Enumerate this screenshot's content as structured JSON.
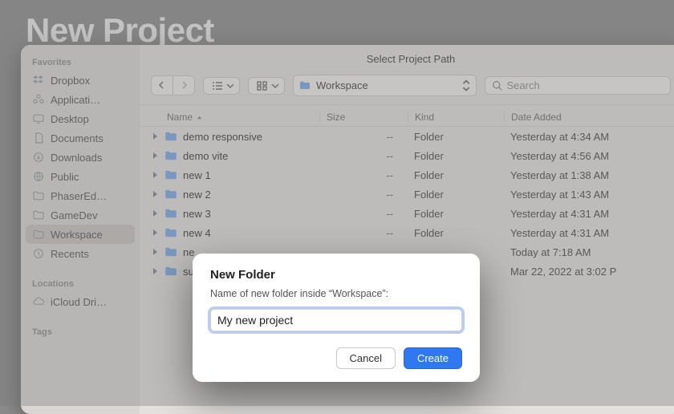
{
  "page_title": "New Project",
  "window_title": "Select Project Path",
  "sidebar": {
    "favorites_label": "Favorites",
    "locations_label": "Locations",
    "tags_label": "Tags",
    "items": [
      {
        "label": "Dropbox",
        "icon": "dropbox"
      },
      {
        "label": "Applicati…",
        "icon": "apps"
      },
      {
        "label": "Desktop",
        "icon": "desktop"
      },
      {
        "label": "Documents",
        "icon": "doc"
      },
      {
        "label": "Downloads",
        "icon": "downloads"
      },
      {
        "label": "Public",
        "icon": "public"
      },
      {
        "label": "PhaserEd…",
        "icon": "folder"
      },
      {
        "label": "GameDev",
        "icon": "folder"
      },
      {
        "label": "Workspace",
        "icon": "folder",
        "selected": true
      },
      {
        "label": "Recents",
        "icon": "recents"
      }
    ],
    "locations": [
      {
        "label": "iCloud Dri…",
        "icon": "icloud"
      }
    ]
  },
  "toolbar": {
    "path_label": "Workspace",
    "search_placeholder": "Search"
  },
  "columns": {
    "name": "Name",
    "size": "Size",
    "kind": "Kind",
    "date": "Date Added"
  },
  "rows": [
    {
      "name": "demo responsive",
      "size": "--",
      "kind": "Folder",
      "date": "Yesterday at 4:34 AM"
    },
    {
      "name": "demo vite",
      "size": "--",
      "kind": "Folder",
      "date": "Yesterday at 4:56 AM"
    },
    {
      "name": "new 1",
      "size": "--",
      "kind": "Folder",
      "date": "Yesterday at 1:38 AM"
    },
    {
      "name": "new 2",
      "size": "--",
      "kind": "Folder",
      "date": "Yesterday at 1:43 AM"
    },
    {
      "name": "new 3",
      "size": "--",
      "kind": "Folder",
      "date": "Yesterday at 4:31 AM"
    },
    {
      "name": "new 4",
      "size": "--",
      "kind": "Folder",
      "date": "Yesterday at 4:31 AM"
    },
    {
      "name": "ne",
      "size": "",
      "kind": "",
      "date": "Today at 7:18 AM"
    },
    {
      "name": "su",
      "size": "",
      "kind": "",
      "date": "Mar 22, 2022 at 3:02 P"
    }
  ],
  "dialog": {
    "title": "New Folder",
    "subtitle": "Name of new folder inside “Workspace”:",
    "value": "My new project",
    "cancel": "Cancel",
    "create": "Create"
  }
}
